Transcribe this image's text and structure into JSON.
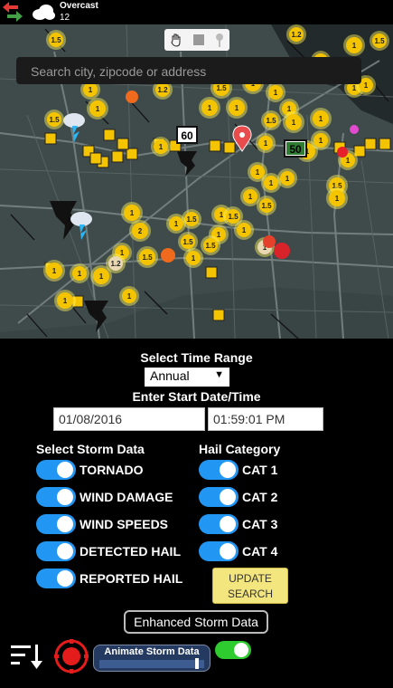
{
  "weather": {
    "condition": "Overcast",
    "temperature": "12"
  },
  "map": {
    "search_placeholder": "Search city, zipcode or address",
    "road_signs": [
      "60",
      "50"
    ],
    "markers": [
      "1.5",
      "1.2",
      "1",
      "1.5",
      "1",
      "1",
      "1.2",
      "1.5",
      "1",
      "1",
      "1",
      "1",
      "1",
      "1",
      "1",
      "1",
      "1.5",
      "1",
      "1",
      "1.5",
      "1",
      "1",
      "1",
      "1",
      "1",
      "1.5",
      "1",
      "1",
      "1",
      "1",
      "1",
      "1.5",
      "1",
      "1.5",
      "1",
      "1.5",
      "2",
      "1",
      "1",
      "1",
      "1",
      "1.5",
      "1",
      "1",
      "1",
      "1",
      "1",
      "1",
      "1.5",
      "1.5",
      "1.2",
      "1"
    ]
  },
  "panel": {
    "time_range_title": "Select Time Range",
    "time_range_value": "Annual",
    "start_title": "Enter Start Date/Time",
    "start_date": "01/08/2016",
    "start_time": "01:59:01 PM",
    "storm_header": "Select Storm Data",
    "hail_header": "Hail Category",
    "storm_items": [
      "TORNADO",
      "WIND DAMAGE",
      "WIND SPEEDS",
      "DETECTED HAIL",
      "REPORTED HAIL"
    ],
    "hail_items": [
      "CAT 1",
      "CAT 2",
      "CAT 3",
      "CAT 4"
    ],
    "update_label": "UPDATE SEARCH",
    "enhanced_label": "Enhanced Storm Data",
    "animate_label": "Animate Storm Data"
  }
}
